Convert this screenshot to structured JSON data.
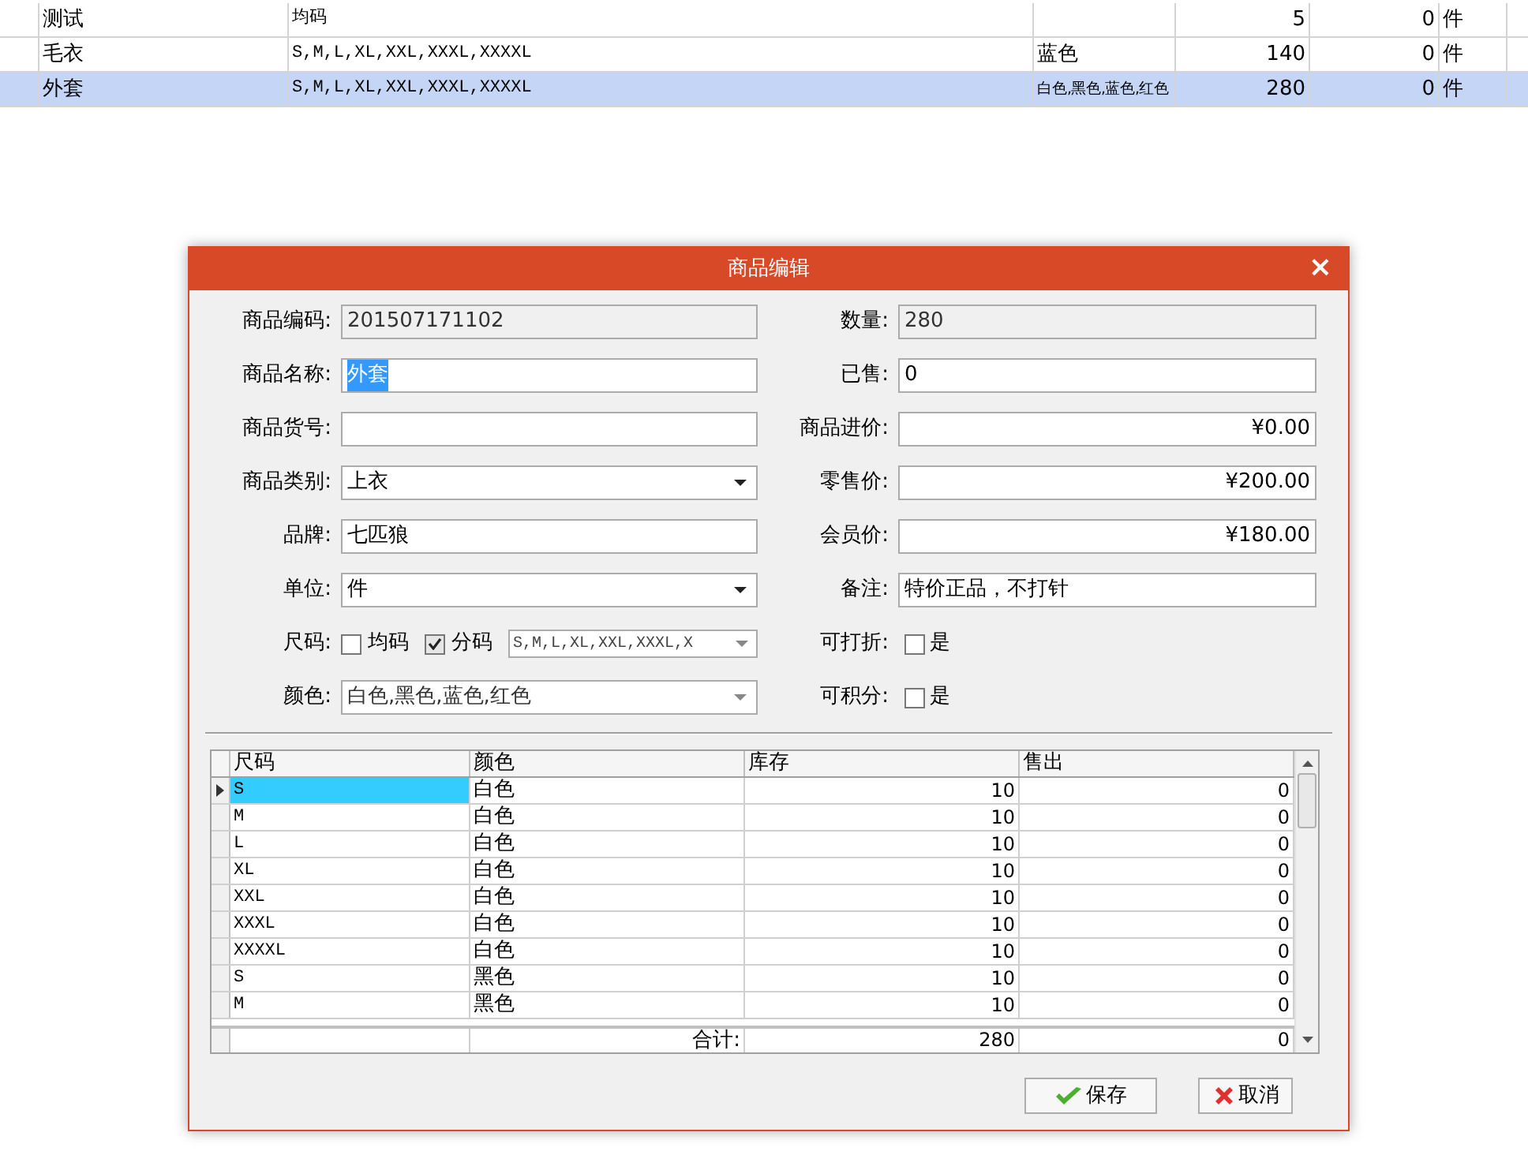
{
  "background_table": {
    "rows": [
      {
        "selected": false,
        "cells": [
          "",
          "测试",
          "均码",
          "",
          "5",
          "0",
          "件"
        ]
      },
      {
        "selected": false,
        "cells": [
          "",
          "毛衣",
          "S,M,L,XL,XXL,XXXL,XXXXL",
          "蓝色",
          "140",
          "0",
          "件"
        ]
      },
      {
        "selected": true,
        "cells": [
          "",
          "外套",
          "S,M,L,XL,XXL,XXXL,XXXXL",
          "白色,黑色,蓝色,红色",
          "280",
          "0",
          "件"
        ]
      }
    ]
  },
  "dialog": {
    "title": "商品编辑",
    "close": "×",
    "left_fields": [
      {
        "kind": "text",
        "label": "商品编码:",
        "value": "201507171102",
        "disabled": true
      },
      {
        "kind": "text",
        "label": "商品名称:",
        "value": "外套",
        "disabled": false,
        "highlighted": true
      },
      {
        "kind": "text",
        "label": "商品货号:",
        "disabled": false
      },
      {
        "kind": "select",
        "label": "商品类别:",
        "value": "上衣"
      },
      {
        "kind": "text",
        "label": "品牌:",
        "value": "七匹狼",
        "disabled": false
      },
      {
        "kind": "select",
        "label": "单位:",
        "value": "件"
      },
      {
        "kind": "sizes",
        "label": "尺码:",
        "options": [
          {
            "label": "均码",
            "checked": false
          },
          {
            "label": "分码",
            "checked": true
          }
        ],
        "value": "S,M,L,XL,XXL,XXXL,X"
      },
      {
        "kind": "multiselect",
        "label": "颜色:",
        "value": "白色,黑色,蓝色,红色"
      }
    ],
    "right_fields": [
      {
        "kind": "text",
        "label": "数量:",
        "value": "280",
        "disabled": true
      },
      {
        "kind": "text",
        "label": "已售:",
        "value": "0",
        "disabled": false
      },
      {
        "kind": "money",
        "label": "商品进价:",
        "value": "¥0.00"
      },
      {
        "kind": "money",
        "label": "零售价:",
        "value": "¥200.00"
      },
      {
        "kind": "money",
        "label": "会员价:",
        "value": "¥180.00"
      },
      {
        "kind": "text",
        "label": "备注:",
        "value": "特价正品，不打针",
        "disabled": false
      },
      {
        "kind": "checkbox",
        "label": "可打折:",
        "option": "是",
        "checked": false
      },
      {
        "kind": "checkbox",
        "label": "可积分:",
        "option": "是",
        "checked": false
      }
    ],
    "grid": {
      "columns": [
        "尺码",
        "颜色",
        "库存",
        "售出"
      ],
      "rows": [
        {
          "selected": true,
          "cells": [
            "S",
            "白色",
            "10",
            "0"
          ]
        },
        {
          "selected": false,
          "cells": [
            "M",
            "白色",
            "10",
            "0"
          ]
        },
        {
          "selected": false,
          "cells": [
            "L",
            "白色",
            "10",
            "0"
          ]
        },
        {
          "selected": false,
          "cells": [
            "XL",
            "白色",
            "10",
            "0"
          ]
        },
        {
          "selected": false,
          "cells": [
            "XXL",
            "白色",
            "10",
            "0"
          ]
        },
        {
          "selected": false,
          "cells": [
            "XXXL",
            "白色",
            "10",
            "0"
          ]
        },
        {
          "selected": false,
          "cells": [
            "XXXXL",
            "白色",
            "10",
            "0"
          ]
        },
        {
          "selected": false,
          "cells": [
            "S",
            "黑色",
            "10",
            "0"
          ]
        },
        {
          "selected": false,
          "cells": [
            "M",
            "黑色",
            "10",
            "0"
          ]
        }
      ],
      "totals": {
        "label": "合计:",
        "stock": "280",
        "sold": "0"
      }
    },
    "buttons": [
      {
        "kind": "save",
        "label": "保存"
      },
      {
        "kind": "cancel",
        "label": "取消"
      }
    ]
  }
}
